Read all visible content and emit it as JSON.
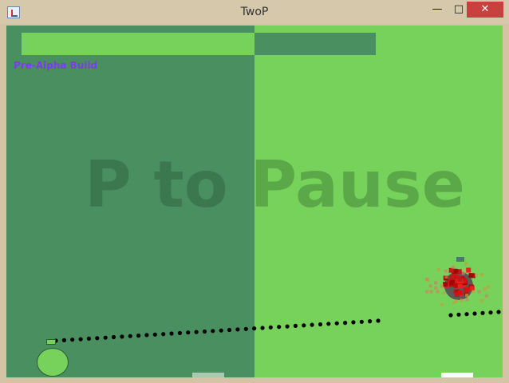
{
  "window": {
    "title": "TwoP",
    "minimize_label": "—",
    "maximize_label": "□",
    "close_label": "✕"
  },
  "game": {
    "build_label": "Pre-Alpha Build",
    "pause_text": "P to Pause",
    "colors": {
      "field_light": "#76d25a",
      "field_dark": "#4a8f60",
      "build_text": "#7b3cf0",
      "enemy": "#d81010"
    },
    "health": {
      "player_left_fraction": 1.0,
      "player_right_fraction": 1.0
    }
  }
}
